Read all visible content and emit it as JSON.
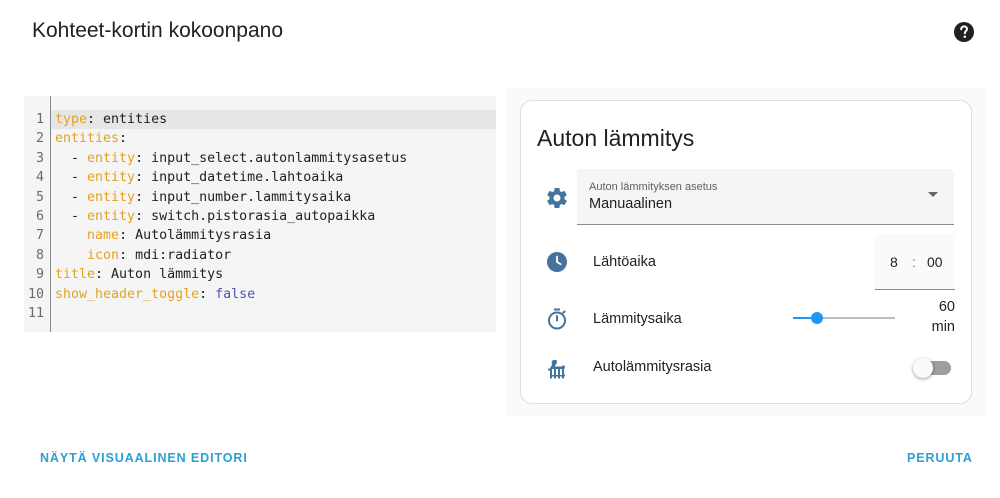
{
  "dialog": {
    "title": "Kohteet-kortin kokoonpano",
    "help_icon": "help-circle-icon"
  },
  "editor": {
    "line_numbers": [
      "1",
      "2",
      "3",
      "4",
      "5",
      "6",
      "7",
      "8",
      "9",
      "10",
      "11"
    ],
    "active_line": 1,
    "lines": [
      [
        {
          "t": "type",
          "c": "k"
        },
        {
          "t": ": entities",
          "c": "v"
        }
      ],
      [
        {
          "t": "entities",
          "c": "k"
        },
        {
          "t": ":",
          "c": "v"
        }
      ],
      [
        {
          "t": "  - ",
          "c": "v"
        },
        {
          "t": "entity",
          "c": "k"
        },
        {
          "t": ": input_select.autonlammitysasetus",
          "c": "v"
        }
      ],
      [
        {
          "t": "  - ",
          "c": "v"
        },
        {
          "t": "entity",
          "c": "k"
        },
        {
          "t": ": input_datetime.lahtoaika",
          "c": "v"
        }
      ],
      [
        {
          "t": "  - ",
          "c": "v"
        },
        {
          "t": "entity",
          "c": "k"
        },
        {
          "t": ": input_number.lammitysaika",
          "c": "v"
        }
      ],
      [
        {
          "t": "  - ",
          "c": "v"
        },
        {
          "t": "entity",
          "c": "k"
        },
        {
          "t": ": switch.pistorasia_autopaikka",
          "c": "v"
        }
      ],
      [
        {
          "t": "    ",
          "c": "v"
        },
        {
          "t": "name",
          "c": "k"
        },
        {
          "t": ": Autolämmitysrasia",
          "c": "v"
        }
      ],
      [
        {
          "t": "    ",
          "c": "v"
        },
        {
          "t": "icon",
          "c": "k"
        },
        {
          "t": ": mdi:radiator",
          "c": "v"
        }
      ],
      [
        {
          "t": "title",
          "c": "k"
        },
        {
          "t": ": Auton lämmitys",
          "c": "v"
        }
      ],
      [
        {
          "t": "show_header_toggle",
          "c": "k"
        },
        {
          "t": ": ",
          "c": "v"
        },
        {
          "t": "false",
          "c": "b"
        }
      ],
      []
    ]
  },
  "card": {
    "title": "Auton lämmitys",
    "select": {
      "icon": "gear-icon",
      "label": "Auton lämmityksen asetus",
      "value": "Manuaalinen"
    },
    "time": {
      "icon": "clock-icon",
      "label": "Lähtöaika",
      "hour": "8",
      "separator": ":",
      "minute": "00"
    },
    "slider": {
      "icon": "timer-icon",
      "label": "Lämmitysaika",
      "value": "60",
      "unit": "min",
      "fraction": 0.24
    },
    "switch": {
      "icon": "radiator-icon",
      "label": "Autolämmitysrasia",
      "on": false
    }
  },
  "actions": {
    "visual_editor": "NÄYTÄ VISUAALINEN EDITORI",
    "cancel": "PERUUTA"
  },
  "colors": {
    "accent": "#2196f3",
    "button_text": "#2a9fd8",
    "icon": "#44739e",
    "yaml_key": "#e6a21e",
    "yaml_bool": "#4d55b8"
  }
}
